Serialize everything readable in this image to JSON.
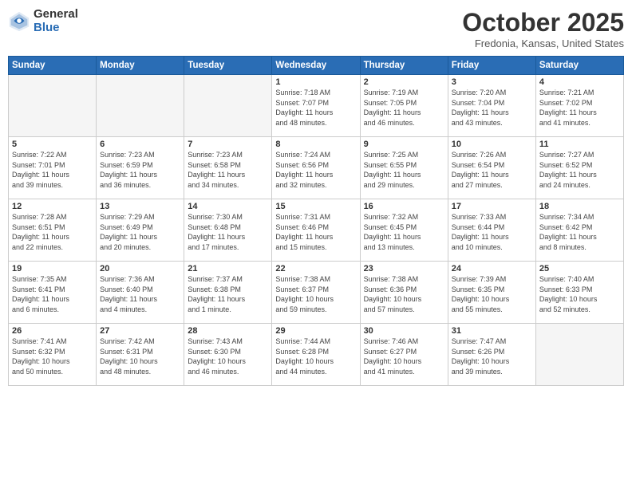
{
  "logo": {
    "general": "General",
    "blue": "Blue"
  },
  "title": "October 2025",
  "location": "Fredonia, Kansas, United States",
  "days_of_week": [
    "Sunday",
    "Monday",
    "Tuesday",
    "Wednesday",
    "Thursday",
    "Friday",
    "Saturday"
  ],
  "weeks": [
    [
      {
        "day": "",
        "info": ""
      },
      {
        "day": "",
        "info": ""
      },
      {
        "day": "",
        "info": ""
      },
      {
        "day": "1",
        "info": "Sunrise: 7:18 AM\nSunset: 7:07 PM\nDaylight: 11 hours\nand 48 minutes."
      },
      {
        "day": "2",
        "info": "Sunrise: 7:19 AM\nSunset: 7:05 PM\nDaylight: 11 hours\nand 46 minutes."
      },
      {
        "day": "3",
        "info": "Sunrise: 7:20 AM\nSunset: 7:04 PM\nDaylight: 11 hours\nand 43 minutes."
      },
      {
        "day": "4",
        "info": "Sunrise: 7:21 AM\nSunset: 7:02 PM\nDaylight: 11 hours\nand 41 minutes."
      }
    ],
    [
      {
        "day": "5",
        "info": "Sunrise: 7:22 AM\nSunset: 7:01 PM\nDaylight: 11 hours\nand 39 minutes."
      },
      {
        "day": "6",
        "info": "Sunrise: 7:23 AM\nSunset: 6:59 PM\nDaylight: 11 hours\nand 36 minutes."
      },
      {
        "day": "7",
        "info": "Sunrise: 7:23 AM\nSunset: 6:58 PM\nDaylight: 11 hours\nand 34 minutes."
      },
      {
        "day": "8",
        "info": "Sunrise: 7:24 AM\nSunset: 6:56 PM\nDaylight: 11 hours\nand 32 minutes."
      },
      {
        "day": "9",
        "info": "Sunrise: 7:25 AM\nSunset: 6:55 PM\nDaylight: 11 hours\nand 29 minutes."
      },
      {
        "day": "10",
        "info": "Sunrise: 7:26 AM\nSunset: 6:54 PM\nDaylight: 11 hours\nand 27 minutes."
      },
      {
        "day": "11",
        "info": "Sunrise: 7:27 AM\nSunset: 6:52 PM\nDaylight: 11 hours\nand 24 minutes."
      }
    ],
    [
      {
        "day": "12",
        "info": "Sunrise: 7:28 AM\nSunset: 6:51 PM\nDaylight: 11 hours\nand 22 minutes."
      },
      {
        "day": "13",
        "info": "Sunrise: 7:29 AM\nSunset: 6:49 PM\nDaylight: 11 hours\nand 20 minutes."
      },
      {
        "day": "14",
        "info": "Sunrise: 7:30 AM\nSunset: 6:48 PM\nDaylight: 11 hours\nand 17 minutes."
      },
      {
        "day": "15",
        "info": "Sunrise: 7:31 AM\nSunset: 6:46 PM\nDaylight: 11 hours\nand 15 minutes."
      },
      {
        "day": "16",
        "info": "Sunrise: 7:32 AM\nSunset: 6:45 PM\nDaylight: 11 hours\nand 13 minutes."
      },
      {
        "day": "17",
        "info": "Sunrise: 7:33 AM\nSunset: 6:44 PM\nDaylight: 11 hours\nand 10 minutes."
      },
      {
        "day": "18",
        "info": "Sunrise: 7:34 AM\nSunset: 6:42 PM\nDaylight: 11 hours\nand 8 minutes."
      }
    ],
    [
      {
        "day": "19",
        "info": "Sunrise: 7:35 AM\nSunset: 6:41 PM\nDaylight: 11 hours\nand 6 minutes."
      },
      {
        "day": "20",
        "info": "Sunrise: 7:36 AM\nSunset: 6:40 PM\nDaylight: 11 hours\nand 4 minutes."
      },
      {
        "day": "21",
        "info": "Sunrise: 7:37 AM\nSunset: 6:38 PM\nDaylight: 11 hours\nand 1 minute."
      },
      {
        "day": "22",
        "info": "Sunrise: 7:38 AM\nSunset: 6:37 PM\nDaylight: 10 hours\nand 59 minutes."
      },
      {
        "day": "23",
        "info": "Sunrise: 7:38 AM\nSunset: 6:36 PM\nDaylight: 10 hours\nand 57 minutes."
      },
      {
        "day": "24",
        "info": "Sunrise: 7:39 AM\nSunset: 6:35 PM\nDaylight: 10 hours\nand 55 minutes."
      },
      {
        "day": "25",
        "info": "Sunrise: 7:40 AM\nSunset: 6:33 PM\nDaylight: 10 hours\nand 52 minutes."
      }
    ],
    [
      {
        "day": "26",
        "info": "Sunrise: 7:41 AM\nSunset: 6:32 PM\nDaylight: 10 hours\nand 50 minutes."
      },
      {
        "day": "27",
        "info": "Sunrise: 7:42 AM\nSunset: 6:31 PM\nDaylight: 10 hours\nand 48 minutes."
      },
      {
        "day": "28",
        "info": "Sunrise: 7:43 AM\nSunset: 6:30 PM\nDaylight: 10 hours\nand 46 minutes."
      },
      {
        "day": "29",
        "info": "Sunrise: 7:44 AM\nSunset: 6:28 PM\nDaylight: 10 hours\nand 44 minutes."
      },
      {
        "day": "30",
        "info": "Sunrise: 7:46 AM\nSunset: 6:27 PM\nDaylight: 10 hours\nand 41 minutes."
      },
      {
        "day": "31",
        "info": "Sunrise: 7:47 AM\nSunset: 6:26 PM\nDaylight: 10 hours\nand 39 minutes."
      },
      {
        "day": "",
        "info": ""
      }
    ]
  ]
}
